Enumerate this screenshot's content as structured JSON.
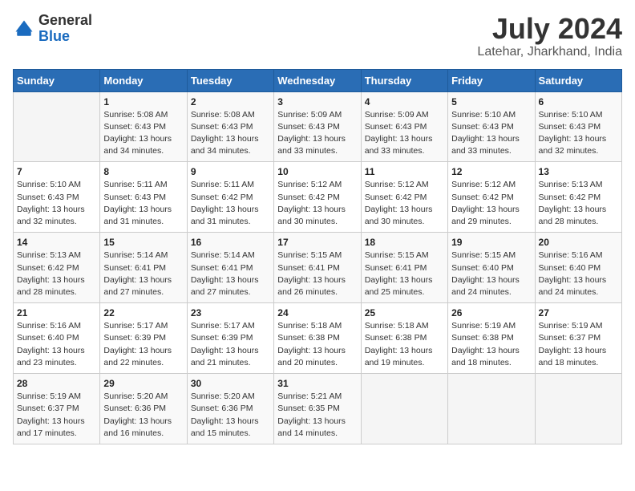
{
  "header": {
    "logo_general": "General",
    "logo_blue": "Blue",
    "month_title": "July 2024",
    "location": "Latehar, Jharkhand, India"
  },
  "days_of_week": [
    "Sunday",
    "Monday",
    "Tuesday",
    "Wednesday",
    "Thursday",
    "Friday",
    "Saturday"
  ],
  "weeks": [
    [
      {
        "day": "",
        "info": ""
      },
      {
        "day": "1",
        "info": "Sunrise: 5:08 AM\nSunset: 6:43 PM\nDaylight: 13 hours\nand 34 minutes."
      },
      {
        "day": "2",
        "info": "Sunrise: 5:08 AM\nSunset: 6:43 PM\nDaylight: 13 hours\nand 34 minutes."
      },
      {
        "day": "3",
        "info": "Sunrise: 5:09 AM\nSunset: 6:43 PM\nDaylight: 13 hours\nand 33 minutes."
      },
      {
        "day": "4",
        "info": "Sunrise: 5:09 AM\nSunset: 6:43 PM\nDaylight: 13 hours\nand 33 minutes."
      },
      {
        "day": "5",
        "info": "Sunrise: 5:10 AM\nSunset: 6:43 PM\nDaylight: 13 hours\nand 33 minutes."
      },
      {
        "day": "6",
        "info": "Sunrise: 5:10 AM\nSunset: 6:43 PM\nDaylight: 13 hours\nand 32 minutes."
      }
    ],
    [
      {
        "day": "7",
        "info": "Sunrise: 5:10 AM\nSunset: 6:43 PM\nDaylight: 13 hours\nand 32 minutes."
      },
      {
        "day": "8",
        "info": "Sunrise: 5:11 AM\nSunset: 6:43 PM\nDaylight: 13 hours\nand 31 minutes."
      },
      {
        "day": "9",
        "info": "Sunrise: 5:11 AM\nSunset: 6:42 PM\nDaylight: 13 hours\nand 31 minutes."
      },
      {
        "day": "10",
        "info": "Sunrise: 5:12 AM\nSunset: 6:42 PM\nDaylight: 13 hours\nand 30 minutes."
      },
      {
        "day": "11",
        "info": "Sunrise: 5:12 AM\nSunset: 6:42 PM\nDaylight: 13 hours\nand 30 minutes."
      },
      {
        "day": "12",
        "info": "Sunrise: 5:12 AM\nSunset: 6:42 PM\nDaylight: 13 hours\nand 29 minutes."
      },
      {
        "day": "13",
        "info": "Sunrise: 5:13 AM\nSunset: 6:42 PM\nDaylight: 13 hours\nand 28 minutes."
      }
    ],
    [
      {
        "day": "14",
        "info": "Sunrise: 5:13 AM\nSunset: 6:42 PM\nDaylight: 13 hours\nand 28 minutes."
      },
      {
        "day": "15",
        "info": "Sunrise: 5:14 AM\nSunset: 6:41 PM\nDaylight: 13 hours\nand 27 minutes."
      },
      {
        "day": "16",
        "info": "Sunrise: 5:14 AM\nSunset: 6:41 PM\nDaylight: 13 hours\nand 27 minutes."
      },
      {
        "day": "17",
        "info": "Sunrise: 5:15 AM\nSunset: 6:41 PM\nDaylight: 13 hours\nand 26 minutes."
      },
      {
        "day": "18",
        "info": "Sunrise: 5:15 AM\nSunset: 6:41 PM\nDaylight: 13 hours\nand 25 minutes."
      },
      {
        "day": "19",
        "info": "Sunrise: 5:15 AM\nSunset: 6:40 PM\nDaylight: 13 hours\nand 24 minutes."
      },
      {
        "day": "20",
        "info": "Sunrise: 5:16 AM\nSunset: 6:40 PM\nDaylight: 13 hours\nand 24 minutes."
      }
    ],
    [
      {
        "day": "21",
        "info": "Sunrise: 5:16 AM\nSunset: 6:40 PM\nDaylight: 13 hours\nand 23 minutes."
      },
      {
        "day": "22",
        "info": "Sunrise: 5:17 AM\nSunset: 6:39 PM\nDaylight: 13 hours\nand 22 minutes."
      },
      {
        "day": "23",
        "info": "Sunrise: 5:17 AM\nSunset: 6:39 PM\nDaylight: 13 hours\nand 21 minutes."
      },
      {
        "day": "24",
        "info": "Sunrise: 5:18 AM\nSunset: 6:38 PM\nDaylight: 13 hours\nand 20 minutes."
      },
      {
        "day": "25",
        "info": "Sunrise: 5:18 AM\nSunset: 6:38 PM\nDaylight: 13 hours\nand 19 minutes."
      },
      {
        "day": "26",
        "info": "Sunrise: 5:19 AM\nSunset: 6:38 PM\nDaylight: 13 hours\nand 18 minutes."
      },
      {
        "day": "27",
        "info": "Sunrise: 5:19 AM\nSunset: 6:37 PM\nDaylight: 13 hours\nand 18 minutes."
      }
    ],
    [
      {
        "day": "28",
        "info": "Sunrise: 5:19 AM\nSunset: 6:37 PM\nDaylight: 13 hours\nand 17 minutes."
      },
      {
        "day": "29",
        "info": "Sunrise: 5:20 AM\nSunset: 6:36 PM\nDaylight: 13 hours\nand 16 minutes."
      },
      {
        "day": "30",
        "info": "Sunrise: 5:20 AM\nSunset: 6:36 PM\nDaylight: 13 hours\nand 15 minutes."
      },
      {
        "day": "31",
        "info": "Sunrise: 5:21 AM\nSunset: 6:35 PM\nDaylight: 13 hours\nand 14 minutes."
      },
      {
        "day": "",
        "info": ""
      },
      {
        "day": "",
        "info": ""
      },
      {
        "day": "",
        "info": ""
      }
    ]
  ]
}
